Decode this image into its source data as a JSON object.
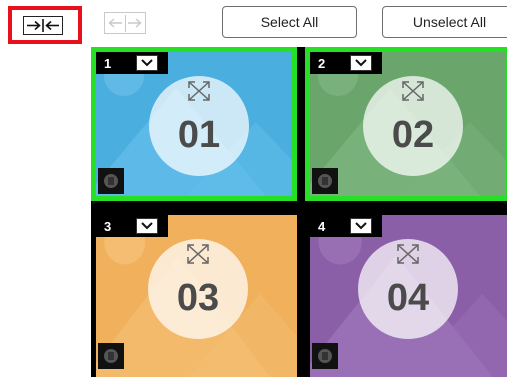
{
  "toolbar": {
    "collapse_icon": "collapse-arrows-icon",
    "expand_icon": "expand-arrows-icon",
    "select_all_label": "Select All",
    "unselect_all_label": "Unselect All"
  },
  "tiles": [
    {
      "number": "1",
      "label": "01",
      "selected": true,
      "color": "#4aaedf"
    },
    {
      "number": "2",
      "label": "02",
      "selected": true,
      "color": "#6aa56c"
    },
    {
      "number": "3",
      "label": "03",
      "selected": false,
      "color": "#f0b05c"
    },
    {
      "number": "4",
      "label": "04",
      "selected": false,
      "color": "#8b5fa8"
    }
  ],
  "colors": {
    "highlight_red": "#e8101d",
    "selected_green": "#25e025"
  }
}
